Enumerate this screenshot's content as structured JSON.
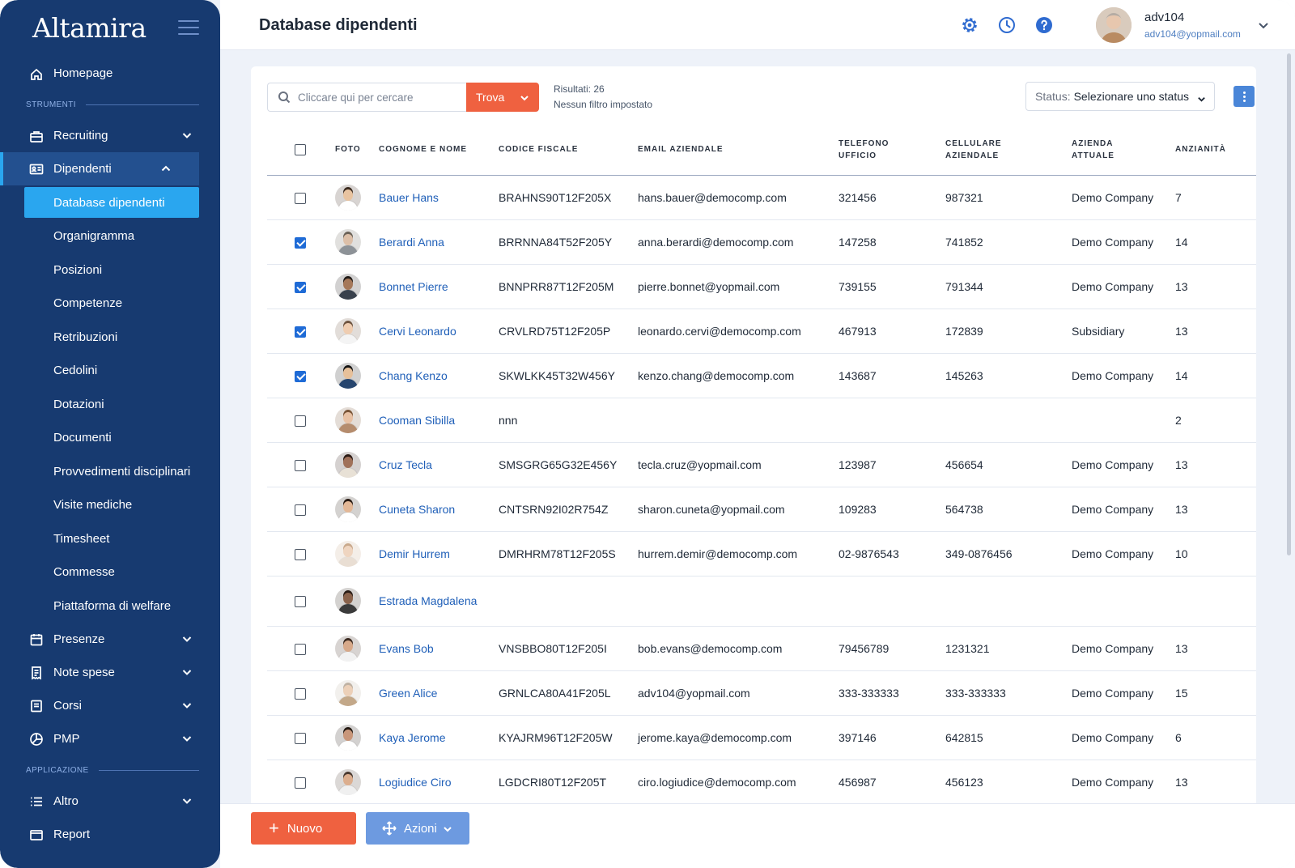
{
  "app": {
    "logo": "Altamira"
  },
  "sidebar": {
    "top_items": [
      {
        "label": "Homepage",
        "icon": "home-icon"
      }
    ],
    "section_tools": "STRUMENTI",
    "recruiting": {
      "label": "Recruiting",
      "icon": "briefcase-icon"
    },
    "dipendenti": {
      "label": "Dipendenti",
      "icon": "id-card-icon",
      "sub": [
        "Database dipendenti",
        "Organigramma",
        "Posizioni",
        "Competenze",
        "Retribuzioni",
        "Cedolini",
        "Dotazioni",
        "Documenti",
        "Provvedimenti disciplinari",
        "Visite mediche",
        "Timesheet",
        "Commesse",
        "Piattaforma di welfare"
      ]
    },
    "after_items": [
      {
        "label": "Presenze",
        "icon": "calendar-icon"
      },
      {
        "label": "Note spese",
        "icon": "receipt-icon"
      },
      {
        "label": "Corsi",
        "icon": "book-icon"
      },
      {
        "label": "PMP",
        "icon": "pie-chart-icon"
      }
    ],
    "section_app": "APPLICAZIONE",
    "app_items": [
      {
        "label": "Altro",
        "icon": "list-icon"
      }
    ],
    "cut_item": {
      "label": "Report",
      "icon": "report-icon"
    }
  },
  "header": {
    "title": "Database dipendenti",
    "icons": [
      "gear-icon",
      "clock-icon",
      "help-icon"
    ],
    "user": {
      "name": "adv104",
      "email": "adv104@yopmail.com"
    }
  },
  "toolbar": {
    "search_placeholder": "Cliccare qui per cercare",
    "find_label": "Trova",
    "results": "Risultati: 26",
    "filter": "Nessun filtro impostato",
    "status_label": "Status:",
    "status_value": "Selezionare uno status"
  },
  "table": {
    "headers": [
      "FOTO",
      "COGNOME E NOME",
      "CODICE FISCALE",
      "EMAIL AZIENDALE",
      "TELEFONO UFFICIO",
      "CELLULARE AZIENDALE",
      "AZIENDA ATTUALE",
      "ANZIANITÀ"
    ],
    "rows": [
      {
        "checked": false,
        "name": "Bauer Hans",
        "cf": "BRAHNS90T12F205X",
        "email": "hans.bauer@democomp.com",
        "tel": "321456",
        "cell": "987321",
        "company": "Demo Company",
        "seniority": "7",
        "skin": "#e8c3a0",
        "shirt": "#ffffff",
        "hair": "#3a2a1f"
      },
      {
        "checked": true,
        "name": "Berardi Anna",
        "cf": "BRRNNA84T52F205Y",
        "email": "anna.berardi@democomp.com",
        "tel": "147258",
        "cell": "741852",
        "company": "Demo Company",
        "seniority": "14",
        "skin": "#dcbfa8",
        "shirt": "#8d9297",
        "hair": "#6b6258"
      },
      {
        "checked": true,
        "name": "Bonnet Pierre",
        "cf": "BNNPRR87T12F205M",
        "email": "pierre.bonnet@yopmail.com",
        "tel": "739155",
        "cell": "791344",
        "company": "Demo Company",
        "seniority": "13",
        "skin": "#a5785a",
        "shirt": "#39414d",
        "hair": "#1f1a17"
      },
      {
        "checked": true,
        "name": "Cervi Leonardo",
        "cf": "CRVLRD75T12F205P",
        "email": "leonardo.cervi@democomp.com",
        "tel": "467913",
        "cell": "172839",
        "company": "Subsidiary",
        "seniority": "13",
        "skin": "#efcdb1",
        "shirt": "#f4f4f4",
        "hair": "#6e5440"
      },
      {
        "checked": true,
        "name": "Chang Kenzo",
        "cf": "SKWLKK45T32W456Y",
        "email": "kenzo.chang@democomp.com",
        "tel": "143687",
        "cell": "145263",
        "company": "Demo Company",
        "seniority": "14",
        "skin": "#e6c09a",
        "shirt": "#26456e",
        "hair": "#151515"
      },
      {
        "checked": false,
        "name": "Cooman Sibilla",
        "cf": "nnn",
        "email": "",
        "tel": "",
        "cell": "",
        "company": "",
        "seniority": "2",
        "skin": "#e8c1a4",
        "shirt": "#b58c6d",
        "hair": "#7a5537"
      },
      {
        "checked": false,
        "name": "Cruz Tecla",
        "cf": "SMSGRG65G32E456Y",
        "email": "tecla.cruz@yopmail.com",
        "tel": "123987",
        "cell": "456654",
        "company": "Demo Company",
        "seniority": "13",
        "skin": "#a0715a",
        "shirt": "#e8e1d6",
        "hair": "#2b1b15"
      },
      {
        "checked": false,
        "name": "Cuneta Sharon",
        "cf": "CNTSRN92I02R754Z",
        "email": "sharon.cuneta@yopmail.com",
        "tel": "109283",
        "cell": "564738",
        "company": "Demo Company",
        "seniority": "13",
        "skin": "#e3b897",
        "shirt": "#ffffff",
        "hair": "#2a1c14"
      },
      {
        "checked": false,
        "name": "Demir Hurrem",
        "cf": "DMRHRM78T12F205S",
        "email": "hurrem.demir@democomp.com",
        "tel": "02-9876543",
        "cell": "349-0876456",
        "company": "Demo Company",
        "seniority": "10",
        "skin": "#efd5c0",
        "shirt": "#e9ded3",
        "hair": "#c9a98c"
      },
      {
        "checked": false,
        "name": "Estrada Magdalena",
        "cf": "",
        "email": "",
        "tel": "",
        "cell": "",
        "company": "",
        "seniority": "",
        "skin": "#8a634c",
        "shirt": "#3b3b3b",
        "hair": "#2a1d16",
        "tall": true
      },
      {
        "checked": false,
        "name": "Evans Bob",
        "cf": "VNSBBO80T12F205I",
        "email": "bob.evans@democomp.com",
        "tel": "79456789",
        "cell": "1231321",
        "company": "Demo Company",
        "seniority": "13",
        "skin": "#d7a98a",
        "shirt": "#f2f2f2",
        "hair": "#3b2a20"
      },
      {
        "checked": false,
        "name": "Green Alice",
        "cf": "GRNLCA80A41F205L",
        "email": "adv104@yopmail.com",
        "tel": "333-333333",
        "cell": "333-333333",
        "company": "Demo Company",
        "seniority": "15",
        "skin": "#ecd0b8",
        "shirt": "#c3a889",
        "hair": "#bfb2a4"
      },
      {
        "checked": false,
        "name": "Kaya Jerome",
        "cf": "KYAJRM96T12F205W",
        "email": "jerome.kaya@democomp.com",
        "tel": "397146",
        "cell": "642815",
        "company": "Demo Company",
        "seniority": "6",
        "skin": "#c8967a",
        "shirt": "#ffffff",
        "hair": "#231912"
      },
      {
        "checked": false,
        "name": "Logiudice Ciro",
        "cf": "LGDCRI80T12F205T",
        "email": "ciro.logiudice@democomp.com",
        "tel": "456987",
        "cell": "456123",
        "company": "Demo Company",
        "seniority": "13",
        "skin": "#dcae8e",
        "shirt": "#f0f0f0",
        "hair": "#4a3a30"
      }
    ]
  },
  "footer": {
    "new_label": "Nuovo",
    "actions_label": "Azioni"
  },
  "colors": {
    "sidebar": "#173a70",
    "accent": "#ef6140",
    "highlight": "#2aa6ef",
    "link": "#1f5fb8"
  }
}
